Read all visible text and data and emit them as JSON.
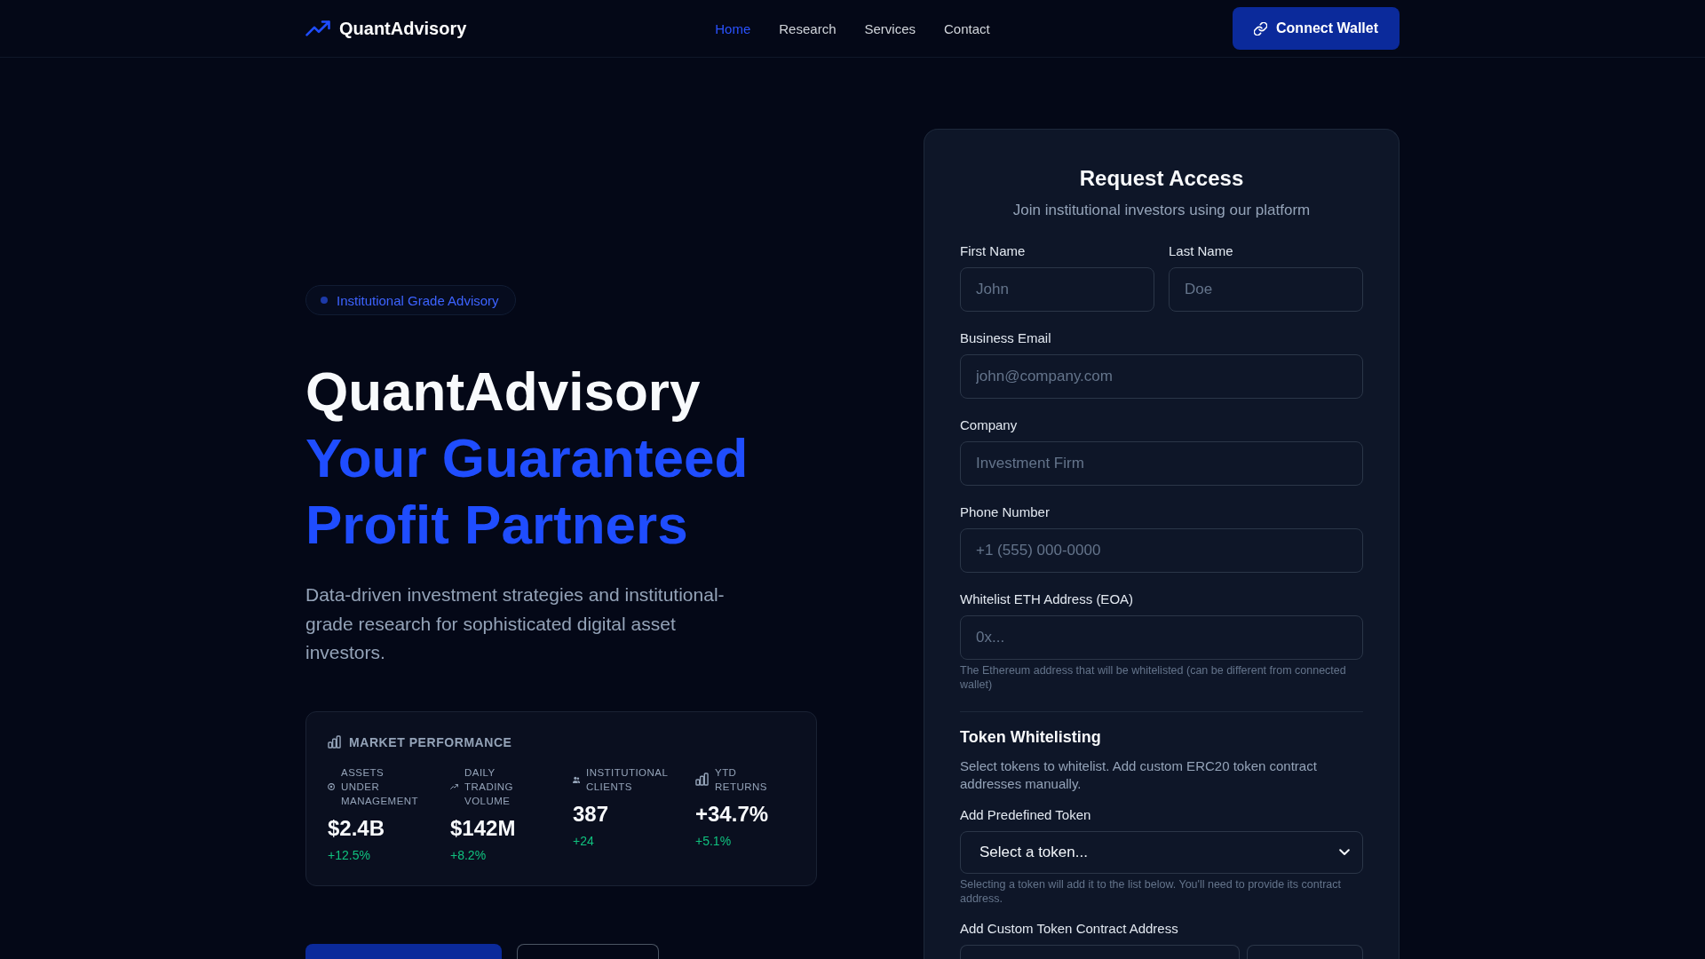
{
  "nav": {
    "brand": "QuantAdvisory",
    "links": [
      {
        "label": "Home",
        "selected": true
      },
      {
        "label": "Research",
        "selected": false
      },
      {
        "label": "Services",
        "selected": false
      },
      {
        "label": "Contact",
        "selected": false
      }
    ],
    "connect_button": "Connect Wallet"
  },
  "hero": {
    "badge": "Institutional Grade Advisory",
    "title": "QuantAdvisory",
    "highlight": "Your Guaranteed Profit Partners",
    "description": "Data-driven investment strategies and institutional-grade research for sophisticated digital asset investors.",
    "market": {
      "title": "MARKET PERFORMANCE",
      "stats": [
        {
          "label": "ASSETS UNDER MANAGEMENT",
          "value": "$2.4B",
          "change": "+12.5%"
        },
        {
          "label": "DAILY TRADING VOLUME",
          "value": "$142M",
          "change": "+8.2%"
        },
        {
          "label": "INSTITUTIONAL CLIENTS",
          "value": "387",
          "change": "+24"
        },
        {
          "label": "YTD RETURNS",
          "value": "+34.7%",
          "change": "+5.1%"
        }
      ]
    },
    "actions": [
      {
        "kind": "primary"
      },
      {
        "kind": "outline"
      }
    ]
  },
  "form": {
    "title": "Request Access",
    "subtitle": "Join institutional investors using our platform",
    "name_fields": [
      {
        "label": "First Name",
        "placeholder": "John"
      },
      {
        "label": "Last Name",
        "placeholder": "Doe"
      }
    ],
    "fields": [
      {
        "label": "Business Email",
        "placeholder": "john@company.com"
      },
      {
        "label": "Company",
        "placeholder": "Investment Firm"
      },
      {
        "label": "Phone Number",
        "placeholder": "+1 (555) 000-0000"
      },
      {
        "label": "Whitelist ETH Address (EOA)",
        "placeholder": "0x...",
        "help": "The Ethereum address that will be whitelisted (can be different from connected wallet)"
      }
    ],
    "token_section": {
      "title": "Token Whitelisting",
      "description": "Select tokens to whitelist. Add custom ERC20 token contract addresses manually.",
      "predefined": {
        "label": "Add Predefined Token",
        "value": "Select a token...",
        "help": "Selecting a token will add it to the list below. You'll need to provide its contract address."
      },
      "custom": {
        "label": "Add Custom Token Contract Address",
        "controls": [
          {
            "kind": "input"
          },
          {
            "kind": "button"
          }
        ]
      }
    }
  }
}
